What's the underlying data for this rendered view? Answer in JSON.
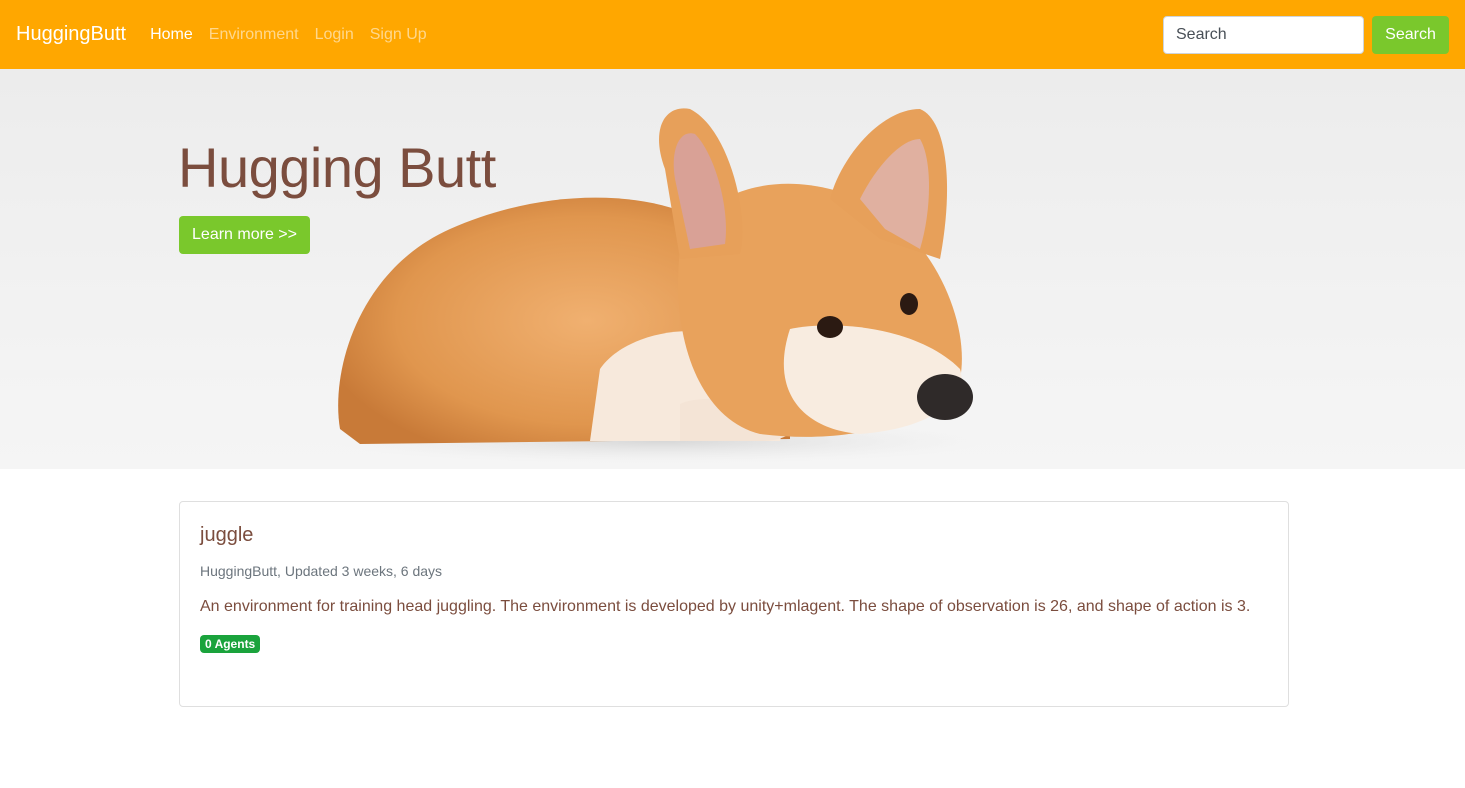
{
  "nav": {
    "brand": "HuggingButt",
    "links": [
      {
        "label": "Home",
        "active": true
      },
      {
        "label": "Environment",
        "active": false
      },
      {
        "label": "Login",
        "active": false
      },
      {
        "label": "Sign Up",
        "active": false
      }
    ],
    "search_placeholder": "Search",
    "search_button": "Search"
  },
  "hero": {
    "title": "Hugging Butt",
    "button": "Learn more >>"
  },
  "card": {
    "title": "juggle",
    "meta": "HuggingButt, Updated 3 weeks, 6 days",
    "description": "An environment for training head juggling. The environment is developed by unity+mlagent. The shape of observation is 26, and shape of action is 3.",
    "badge": "0 Agents"
  },
  "colors": {
    "navbar": "#ffa700",
    "accent_green": "#7ac82c",
    "badge_green": "#1aa33c",
    "text_brown": "#7b4d3e"
  }
}
